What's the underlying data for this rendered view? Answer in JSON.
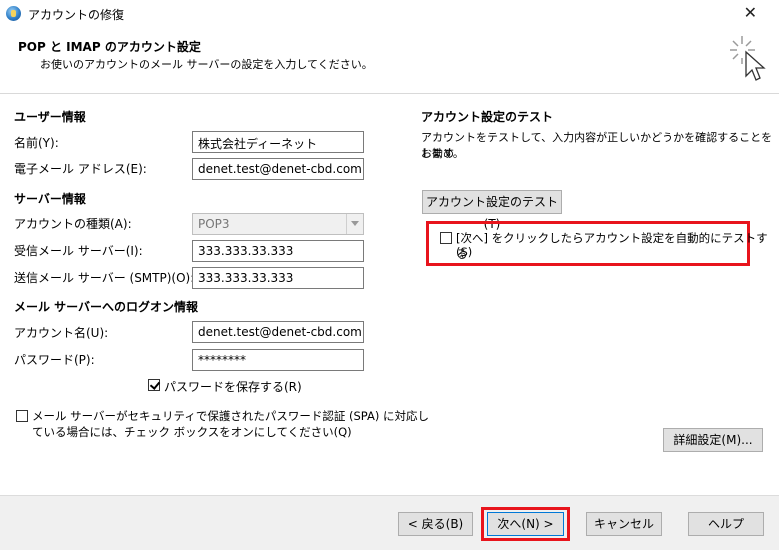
{
  "window": {
    "title": "アカウントの修復"
  },
  "header": {
    "title": "POP と IMAP のアカウント設定",
    "subtitle": "お使いのアカウントのメール サーバーの設定を入力してください。"
  },
  "user_info": {
    "heading": "ユーザー情報",
    "name_label": "名前(Y):",
    "name_value": "株式会社ディーネット",
    "email_label": "電子メール アドレス(E):",
    "email_value": "denet.test@denet-cbd.com"
  },
  "server_info": {
    "heading": "サーバー情報",
    "account_type_label": "アカウントの種類(A):",
    "account_type_value": "POP3",
    "incoming_label": "受信メール サーバー(I):",
    "incoming_value": "333.333.33.333",
    "outgoing_label": "送信メール サーバー (SMTP)(O):",
    "outgoing_value": "333.333.33.333"
  },
  "logon_info": {
    "heading": "メール サーバーへのログオン情報",
    "account_name_label": "アカウント名(U):",
    "account_name_value": "denet.test@denet-cbd.com",
    "password_label": "パスワード(P):",
    "password_value": "********",
    "save_password_label": "パスワードを保存する(R)",
    "save_password_checked": true,
    "spa_label_line1": "メール サーバーがセキュリティで保護されたパスワード認証 (SPA) に対応し",
    "spa_label_line2": "ている場合には、チェック ボックスをオンにしてください(Q)",
    "spa_checked": false
  },
  "test": {
    "heading": "アカウント設定のテスト",
    "description_line1": "アカウントをテストして、入力内容が正しいかどうかを確認することをお勧め",
    "description_line2": "します。",
    "test_button": "アカウント設定のテスト(T)",
    "auto_test_line1": "[次へ] をクリックしたらアカウント設定を自動的にテストする",
    "auto_test_line2": "(S)",
    "auto_test_checked": false,
    "more_settings_button": "詳細設定(M)..."
  },
  "footer": {
    "back_button": "< 戻る(B)",
    "next_button": "次へ(N) >",
    "cancel_button": "キャンセル",
    "help_button": "ヘルプ"
  },
  "colors": {
    "highlight": "#e8141c",
    "focus": "#0078d7"
  }
}
